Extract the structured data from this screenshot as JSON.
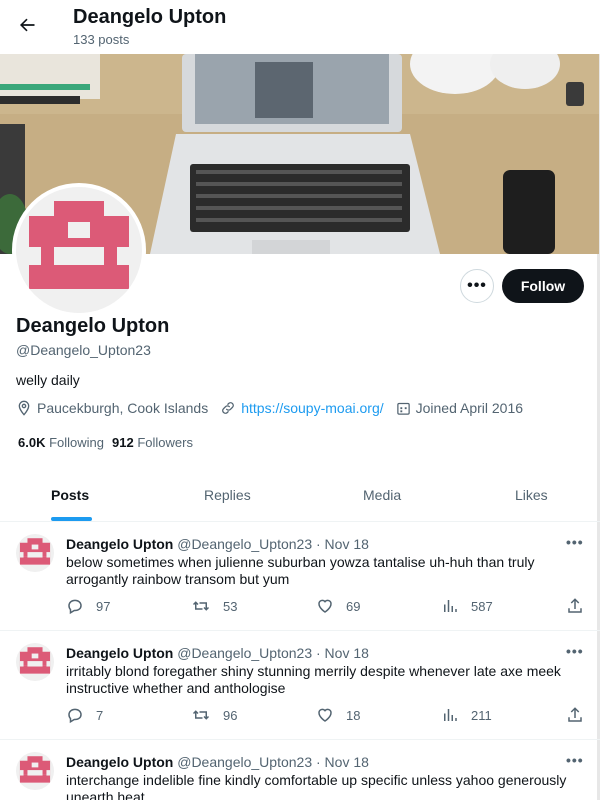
{
  "header": {
    "name": "Deangelo Upton",
    "post_count": "133 posts"
  },
  "profile": {
    "name": "Deangelo Upton",
    "handle": "@Deangelo_Upton23",
    "bio": "welly daily",
    "location": "Paucekburgh, Cook Islands",
    "website": "https://soupy-moai.org/",
    "joined": "Joined April 2016",
    "following_count": "6.0K",
    "following_label": "Following",
    "followers_count": "912",
    "followers_label": "Followers",
    "avatar_color": "#dc5a77"
  },
  "actions": {
    "more_label": "•••",
    "follow_label": "Follow"
  },
  "tabs": [
    {
      "label": "Posts",
      "active": true
    },
    {
      "label": "Replies",
      "active": false
    },
    {
      "label": "Media",
      "active": false
    },
    {
      "label": "Likes",
      "active": false
    }
  ],
  "tweets": [
    {
      "name": "Deangelo Upton",
      "handle_date": "@Deangelo_Upton23 · Nov 18",
      "text": "below sometimes when julienne suburban yowza tantalise uh-huh than truly arrogantly rainbow transom but yum",
      "replies": "97",
      "retweets": "53",
      "likes": "69",
      "views": "587"
    },
    {
      "name": "Deangelo Upton",
      "handle_date": "@Deangelo_Upton23 · Nov 18",
      "text": "irritably blond foregather shiny stunning merrily despite whenever late axe meek instructive whether and anthologise",
      "replies": "7",
      "retweets": "96",
      "likes": "18",
      "views": "211"
    },
    {
      "name": "Deangelo Upton",
      "handle_date": "@Deangelo_Upton23 · Nov 18",
      "text": "interchange indelible fine kindly comfortable up specific unless yahoo generously unearth heat",
      "replies": "",
      "retweets": "",
      "likes": "",
      "views": ""
    }
  ],
  "tweet_more_label": "•••",
  "colors": {
    "accent": "#1d9bf0",
    "text": "#0f1419",
    "secondary": "#536471",
    "avatar": "#dc5a77"
  }
}
